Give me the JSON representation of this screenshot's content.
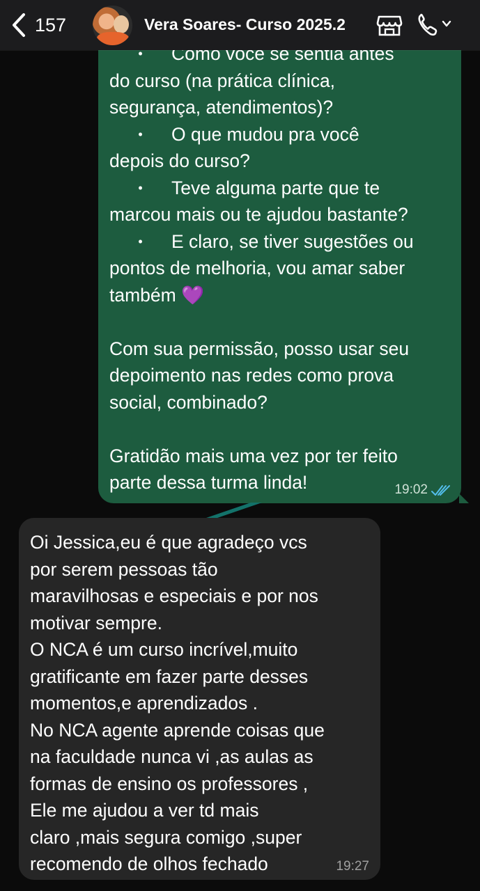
{
  "header": {
    "back_count": "157",
    "title": "Vera Soares- Curso 2025.2"
  },
  "outgoing": {
    "lines": [
      {
        "type": "bullet",
        "text": "Como você se sentia antes"
      },
      {
        "type": "text",
        "text": "do curso (na prática clínica,"
      },
      {
        "type": "text",
        "text": "segurança, atendimentos)?"
      },
      {
        "type": "bullet",
        "text": "O que mudou pra você"
      },
      {
        "type": "text",
        "text": "depois do curso?"
      },
      {
        "type": "bullet",
        "text": "Teve alguma parte que te"
      },
      {
        "type": "text",
        "text": "marcou mais ou te ajudou bastante?"
      },
      {
        "type": "bullet",
        "text": "E claro, se tiver sugestões ou"
      },
      {
        "type": "text",
        "text": "pontos de melhoria, vou amar saber"
      },
      {
        "type": "text",
        "text": "também 💜"
      },
      {
        "type": "blank",
        "text": ""
      },
      {
        "type": "text",
        "text": "Com sua permissão, posso usar seu"
      },
      {
        "type": "text",
        "text": "depoimento nas redes como prova"
      },
      {
        "type": "text",
        "text": "social, combinado?"
      },
      {
        "type": "blank",
        "text": ""
      },
      {
        "type": "text",
        "text": "Gratidão mais uma vez por ter feito"
      },
      {
        "type": "text",
        "text": "parte dessa turma linda!"
      }
    ],
    "time": "19:02"
  },
  "incoming": {
    "lines": [
      "Oi Jessica,eu é que agradeço vcs",
      "por serem pessoas tão",
      "maravilhosas e especiais e por nos",
      "motivar sempre.",
      "O NCA é um curso incrível,muito",
      "gratificante em fazer parte desses",
      "momentos,e aprendizados .",
      "No NCA agente aprende coisas que",
      "na faculdade nunca vi ,as aulas as",
      "formas de ensino os professores ,",
      "Ele me ajudou a ver td mais",
      "claro ,mais segura comigo ,super",
      "recomendo de olhos fechado"
    ],
    "time": "19:27"
  },
  "colors": {
    "outgoing_bubble": "#1d5c3f",
    "incoming_bubble": "#262626",
    "read_ticks": "#53bdeb"
  }
}
